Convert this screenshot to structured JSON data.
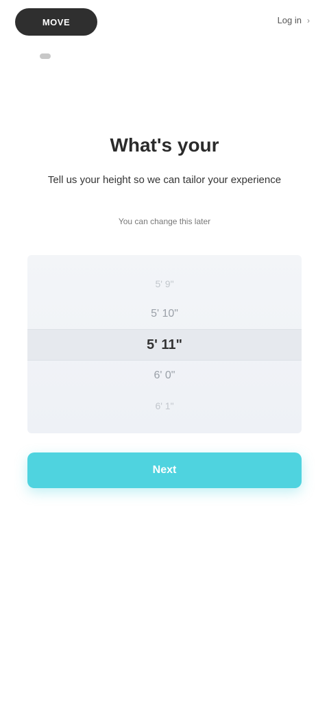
{
  "header": {
    "logo_text": "MOVE",
    "top_link": "Log in",
    "chevron_icon": "chevron-right-icon"
  },
  "main": {
    "title": "What's your",
    "subtitle": "Tell us your height so we can tailor your experience",
    "hint": "You can change this later"
  },
  "picker": {
    "items": [
      "5' 9\"",
      "5' 10\"",
      "5' 11\"",
      "6' 0\"",
      "6' 1\""
    ],
    "selected_index": 2
  },
  "cta": {
    "label": "Next",
    "color": "#4fd3df"
  }
}
